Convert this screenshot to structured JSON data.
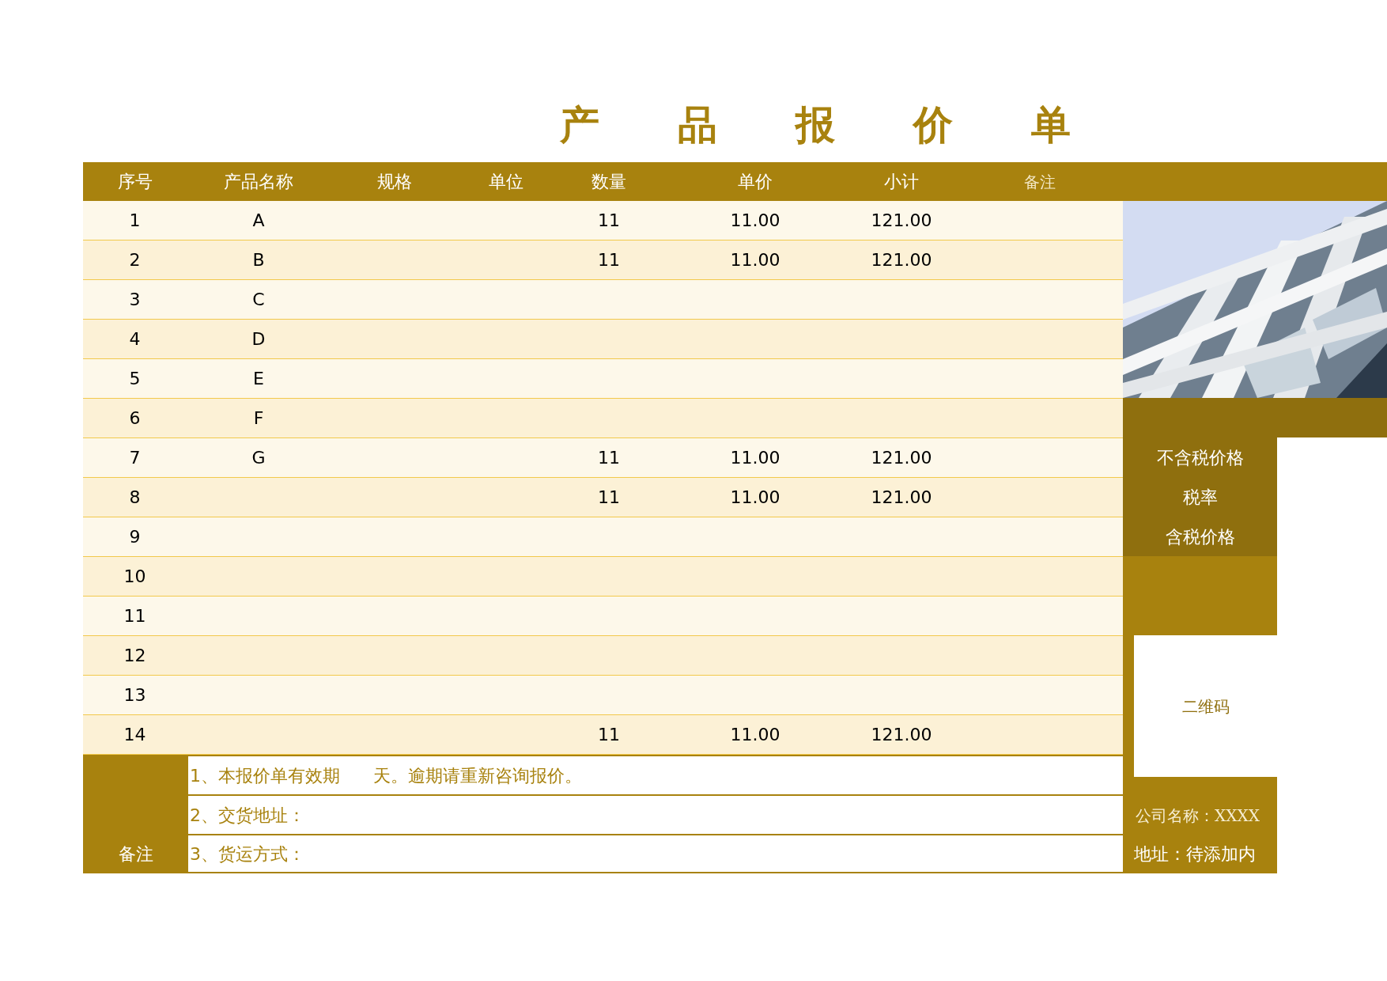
{
  "title": "产品报价单",
  "table": {
    "columns": [
      "序号",
      "产品名称",
      "规格",
      "单位",
      "数量",
      "单价",
      "小计",
      "备注"
    ],
    "rows": [
      {
        "no": "1",
        "name": "A",
        "qty": "11",
        "price": "11.00",
        "subtotal": "121.00"
      },
      {
        "no": "2",
        "name": "B",
        "qty": "11",
        "price": "11.00",
        "subtotal": "121.00"
      },
      {
        "no": "3",
        "name": "C"
      },
      {
        "no": "4",
        "name": "D"
      },
      {
        "no": "5",
        "name": "E"
      },
      {
        "no": "6",
        "name": "F"
      },
      {
        "no": "7",
        "name": "G",
        "qty": "11",
        "price": "11.00",
        "subtotal": "121.00"
      },
      {
        "no": "8",
        "qty": "11",
        "price": "11.00",
        "subtotal": "121.00"
      },
      {
        "no": "9"
      },
      {
        "no": "10"
      },
      {
        "no": "11"
      },
      {
        "no": "12"
      },
      {
        "no": "13"
      },
      {
        "no": "14",
        "qty": "11",
        "price": "11.00",
        "subtotal": "121.00"
      }
    ]
  },
  "remarks": {
    "label": "备注",
    "lines": [
      {
        "before": "1、本报价单有效期",
        "after": "天。逾期请重新咨询报价。"
      },
      {
        "before": "2、交货地址："
      },
      {
        "before": "3、货运方式："
      }
    ]
  },
  "summary": {
    "labels": [
      "不含税价格",
      "税率",
      "含税价格"
    ]
  },
  "qr_code": {
    "label": "二维码"
  },
  "company": {
    "name": "公司名称：XXXX",
    "address": "地址：待添加内"
  }
}
